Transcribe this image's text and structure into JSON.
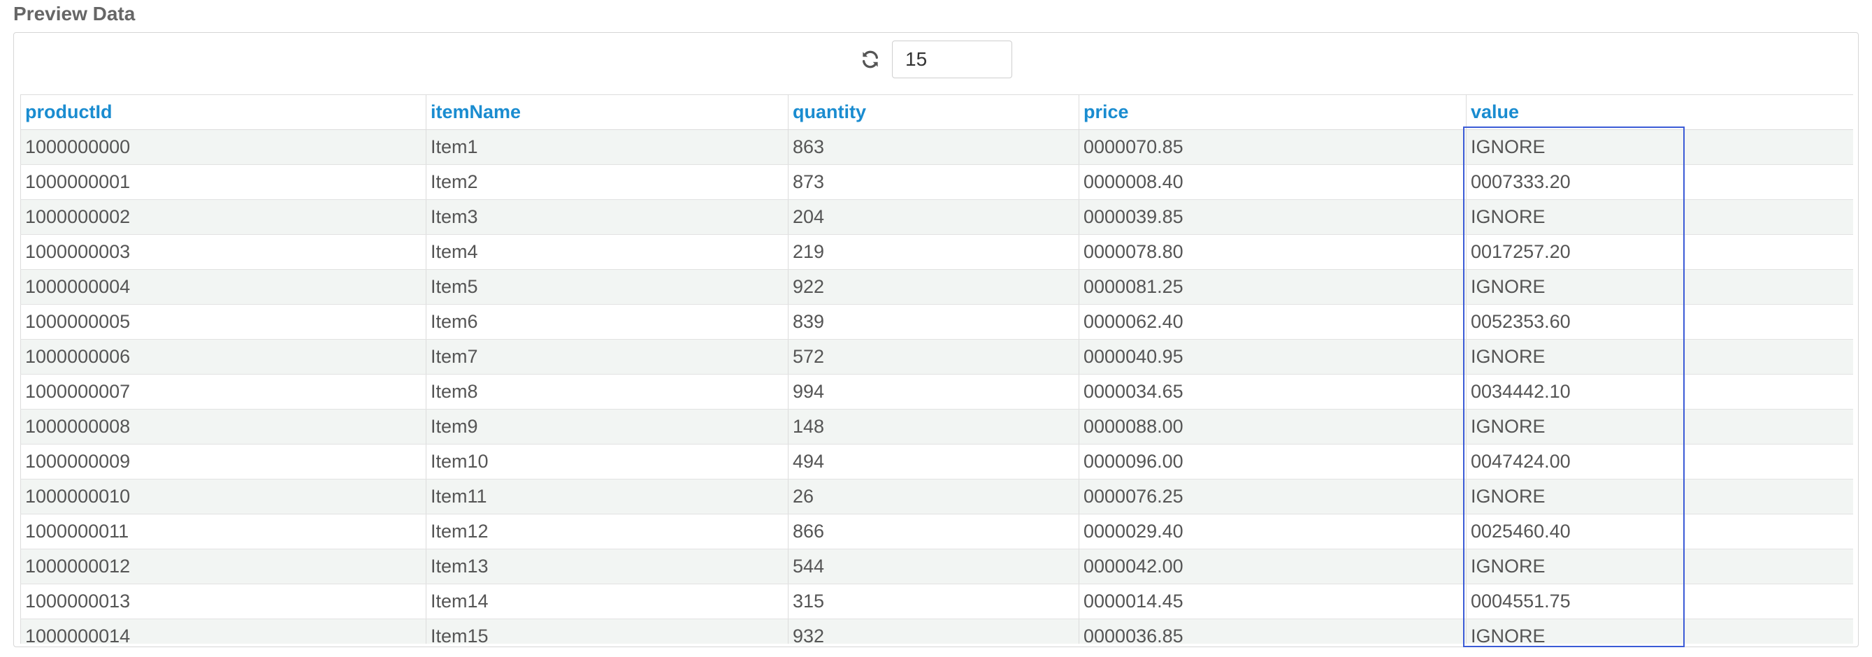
{
  "panel": {
    "title": "Preview Data"
  },
  "toolbar": {
    "refresh_icon": "refresh-icon",
    "rows_value": "15"
  },
  "table": {
    "columns": [
      "productId",
      "itemName",
      "quantity",
      "price",
      "value"
    ],
    "rows": [
      [
        "1000000000",
        "Item1",
        "863",
        "0000070.85",
        "IGNORE"
      ],
      [
        "1000000001",
        "Item2",
        "873",
        "0000008.40",
        "0007333.20"
      ],
      [
        "1000000002",
        "Item3",
        "204",
        "0000039.85",
        "IGNORE"
      ],
      [
        "1000000003",
        "Item4",
        "219",
        "0000078.80",
        "0017257.20"
      ],
      [
        "1000000004",
        "Item5",
        "922",
        "0000081.25",
        "IGNORE"
      ],
      [
        "1000000005",
        "Item6",
        "839",
        "0000062.40",
        "0052353.60"
      ],
      [
        "1000000006",
        "Item7",
        "572",
        "0000040.95",
        "IGNORE"
      ],
      [
        "1000000007",
        "Item8",
        "994",
        "0000034.65",
        "0034442.10"
      ],
      [
        "1000000008",
        "Item9",
        "148",
        "0000088.00",
        "IGNORE"
      ],
      [
        "1000000009",
        "Item10",
        "494",
        "0000096.00",
        "0047424.00"
      ],
      [
        "1000000010",
        "Item11",
        "26",
        "0000076.25",
        "IGNORE"
      ],
      [
        "1000000011",
        "Item12",
        "866",
        "0000029.40",
        "0025460.40"
      ],
      [
        "1000000012",
        "Item13",
        "544",
        "0000042.00",
        "IGNORE"
      ],
      [
        "1000000013",
        "Item14",
        "315",
        "0000014.45",
        "0004551.75"
      ],
      [
        "1000000014",
        "Item15",
        "932",
        "0000036.85",
        "IGNORE"
      ]
    ]
  },
  "colors": {
    "header_text": "#1a8cd0",
    "row_stripe": "#f2f5f3",
    "selection_border": "#3b5bd6"
  }
}
